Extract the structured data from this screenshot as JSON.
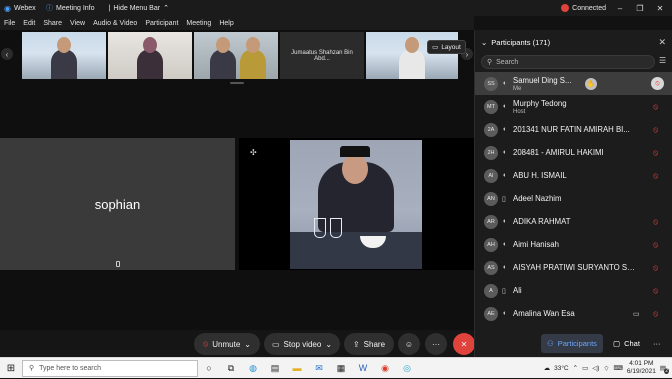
{
  "titlebar": {
    "app_name": "Webex",
    "meeting_info": "Meeting Info",
    "hide_menu_bar": "Hide Menu Bar",
    "status": "Connected",
    "status_color": "#e0433b"
  },
  "menu": [
    "File",
    "Edit",
    "Share",
    "View",
    "Audio & Video",
    "Participant",
    "Meeting",
    "Help"
  ],
  "filmstrip": {
    "name_tile": "Jumaatus Shahzan Bin Abd...",
    "layout_label": "Layout"
  },
  "stage": {
    "sophian_name": "sophian"
  },
  "participants": {
    "header": "Participants (171)",
    "search_placeholder": "Search",
    "list": [
      {
        "initials": "SS",
        "name": "Samuel Ding S...",
        "sub": "Me"
      },
      {
        "initials": "MT",
        "name": "Murphy Tedong",
        "sub": "Host"
      },
      {
        "initials": "2A",
        "name": "201341 NUR FATIN AMIRAH BI..."
      },
      {
        "initials": "2H",
        "name": "208481 - AMIRUL HAKIMI"
      },
      {
        "initials": "AI",
        "name": "ABU H. ISMAIL"
      },
      {
        "initials": "AN",
        "name": "Adeel Nazhim"
      },
      {
        "initials": "AR",
        "name": "ADIKA RAHMAT"
      },
      {
        "initials": "AH",
        "name": "Aimi Hanisah"
      },
      {
        "initials": "AS",
        "name": "AISYAH PRATIWI SURYANTO SU..."
      },
      {
        "initials": "A",
        "name": "Ali"
      },
      {
        "initials": "AE",
        "name": "Amalina Wan Esa"
      }
    ]
  },
  "controls": {
    "unmute": "Unmute",
    "stop_video": "Stop video",
    "share": "Share",
    "participants_tab": "Participants",
    "chat_tab": "Chat"
  },
  "taskbar": {
    "search_placeholder": "Type here to search",
    "temperature": "33°C",
    "time": "4:01 PM",
    "date": "6/19/2021",
    "notif_count": "2"
  }
}
